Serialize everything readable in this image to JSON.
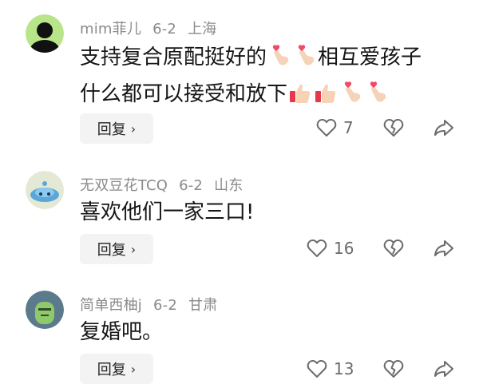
{
  "reply_label": "回复",
  "reply_chevron": "›",
  "comments": [
    {
      "author": "mim菲儿",
      "date": "6-2",
      "location": "上海",
      "line1": "支持复合原配挺好的",
      "line1b": "相互爱孩子",
      "line2": "什么都可以接受和放下",
      "likes": "7",
      "avatar": "black-figure-avatar"
    },
    {
      "author": "无双豆花TCQ",
      "date": "6-2",
      "location": "山东",
      "line1": "喜欢他们一家三口!",
      "likes": "16",
      "avatar": "blue-cartoon-avatar"
    },
    {
      "author": "简单西柚j",
      "date": "6-2",
      "location": "甘肃",
      "line1": "复婚吧。",
      "likes": "13",
      "avatar": "green-cartoon-avatar"
    }
  ],
  "colors": {
    "meta": "#8a8a8a",
    "text": "#161616",
    "reply_bg": "#f3f3f3",
    "icon": "#6b6b6b"
  }
}
